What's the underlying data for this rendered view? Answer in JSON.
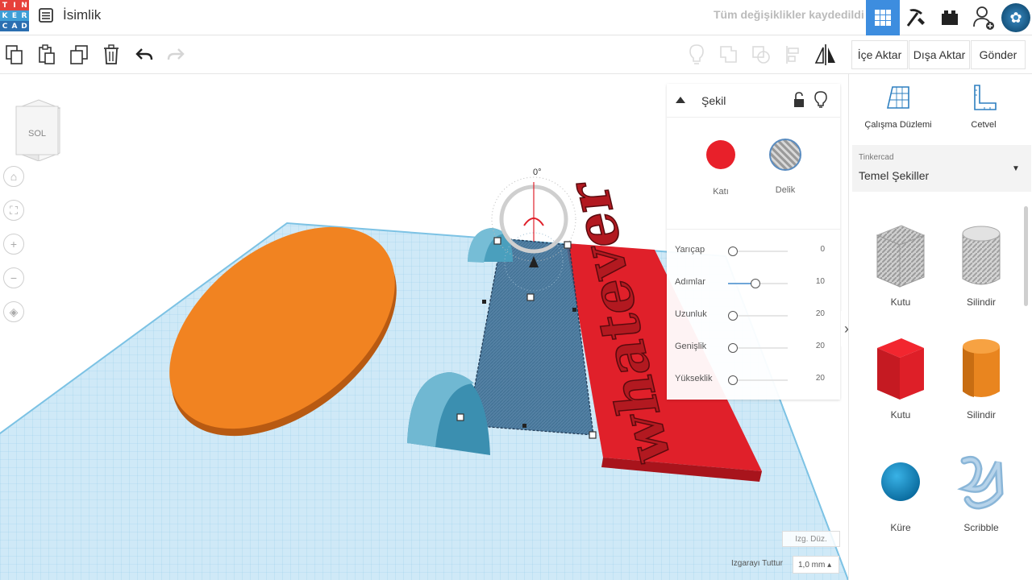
{
  "header": {
    "logo_letters": [
      "T",
      "I",
      "N",
      "K",
      "E",
      "R",
      "C",
      "A",
      "D"
    ],
    "logo_colors": [
      "#e6413b",
      "#e6413b",
      "#e6413b",
      "#3e9ed6",
      "#3e9ed6",
      "#3e9ed6",
      "#2b6fb1",
      "#2b6fb1",
      "#2b6fb1"
    ],
    "doc_title": "İsimlik",
    "save_status": "Tüm değişiklikler kaydedildi",
    "accent": "#3d8ddf"
  },
  "toolbar": {
    "tools": [
      "copy-icon",
      "paste-icon",
      "duplicate-icon",
      "delete-icon",
      "undo-icon",
      "redo-icon"
    ],
    "right_tools": [
      "lightbulb-icon",
      "group-icon",
      "ungroup-icon",
      "align-icon",
      "mirror-icon"
    ],
    "import_label": "İçe Aktar",
    "export_label": "Dışa Aktar",
    "send_label": "Gönder"
  },
  "viewport": {
    "view_cube_label": "SOL",
    "rotation_label": "0°",
    "grid_edit_label": "Izg. Düz.",
    "snap_label": "Izgarayı Tuttur",
    "snap_value": "1,0 mm ▴",
    "text_object": "whatever"
  },
  "inspector": {
    "title": "Şekil",
    "solid_label": "Katı",
    "hole_label": "Delik",
    "solid_color": "#e8202a",
    "props": [
      {
        "label": "Yarıçap",
        "value": "0",
        "level": 0.0
      },
      {
        "label": "Adımlar",
        "value": "10",
        "level": 0.45
      },
      {
        "label": "Uzunluk",
        "value": "20",
        "level": 0.0
      },
      {
        "label": "Genişlik",
        "value": "20",
        "level": 0.0
      },
      {
        "label": "Yükseklik",
        "value": "20",
        "level": 0.0
      }
    ]
  },
  "right_panel": {
    "workplane_label": "Çalışma Düzlemi",
    "ruler_label": "Cetvel",
    "library_source": "Tinkercad",
    "library_name": "Temel Şekiller",
    "shapes": [
      {
        "label": "Kutu",
        "kind": "box-hole"
      },
      {
        "label": "Silindir",
        "kind": "cyl-hole"
      },
      {
        "label": "Kutu",
        "kind": "box"
      },
      {
        "label": "Silindir",
        "kind": "cyl"
      },
      {
        "label": "Küre",
        "kind": "sphere"
      },
      {
        "label": "Scribble",
        "kind": "scribble"
      }
    ]
  }
}
